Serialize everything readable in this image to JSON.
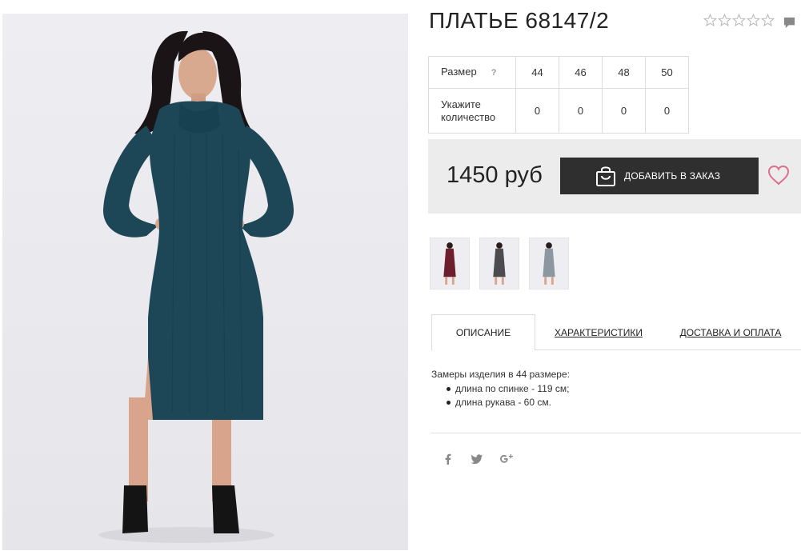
{
  "product": {
    "title": "ПЛАТЬЕ 68147/2",
    "rating_stars": 0,
    "rating_max": 5
  },
  "size_table": {
    "size_label": "Размер",
    "help_mark": "?",
    "sizes": [
      "44",
      "46",
      "48",
      "50"
    ],
    "quantity_label": "Укажите количество",
    "quantities": [
      "0",
      "0",
      "0",
      "0"
    ]
  },
  "buy": {
    "price": "1450 руб",
    "add_to_cart_label": "ДОБАВИТЬ В ЗАКАЗ",
    "icon": "shopping-bag-icon",
    "wishlist_icon": "heart-icon"
  },
  "thumbnails": [
    {
      "dress_color": "#6e1f2e"
    },
    {
      "dress_color": "#4a4c4e"
    },
    {
      "dress_color": "#8c98a0"
    }
  ],
  "main_photo": {
    "dress_color": "#1d4657"
  },
  "tabs": [
    {
      "label": "ОПИСАНИЕ",
      "active": true
    },
    {
      "label": "ХАРАКТЕРИСТИКИ",
      "active": false
    },
    {
      "label": "ДОСТАВКА И ОПЛАТА",
      "active": false
    }
  ],
  "description": {
    "intro": "Замеры изделия в 44 размере:",
    "items": [
      "длина по спинке - 119 см;",
      "длина рукава - 60 см."
    ]
  },
  "social": [
    "facebook-icon",
    "twitter-icon",
    "google-plus-icon"
  ],
  "colors": {
    "button_bg": "#2f2f2f",
    "panel_bg": "#ececec",
    "heart": "#d9708e",
    "star": "#bbbbbb"
  }
}
